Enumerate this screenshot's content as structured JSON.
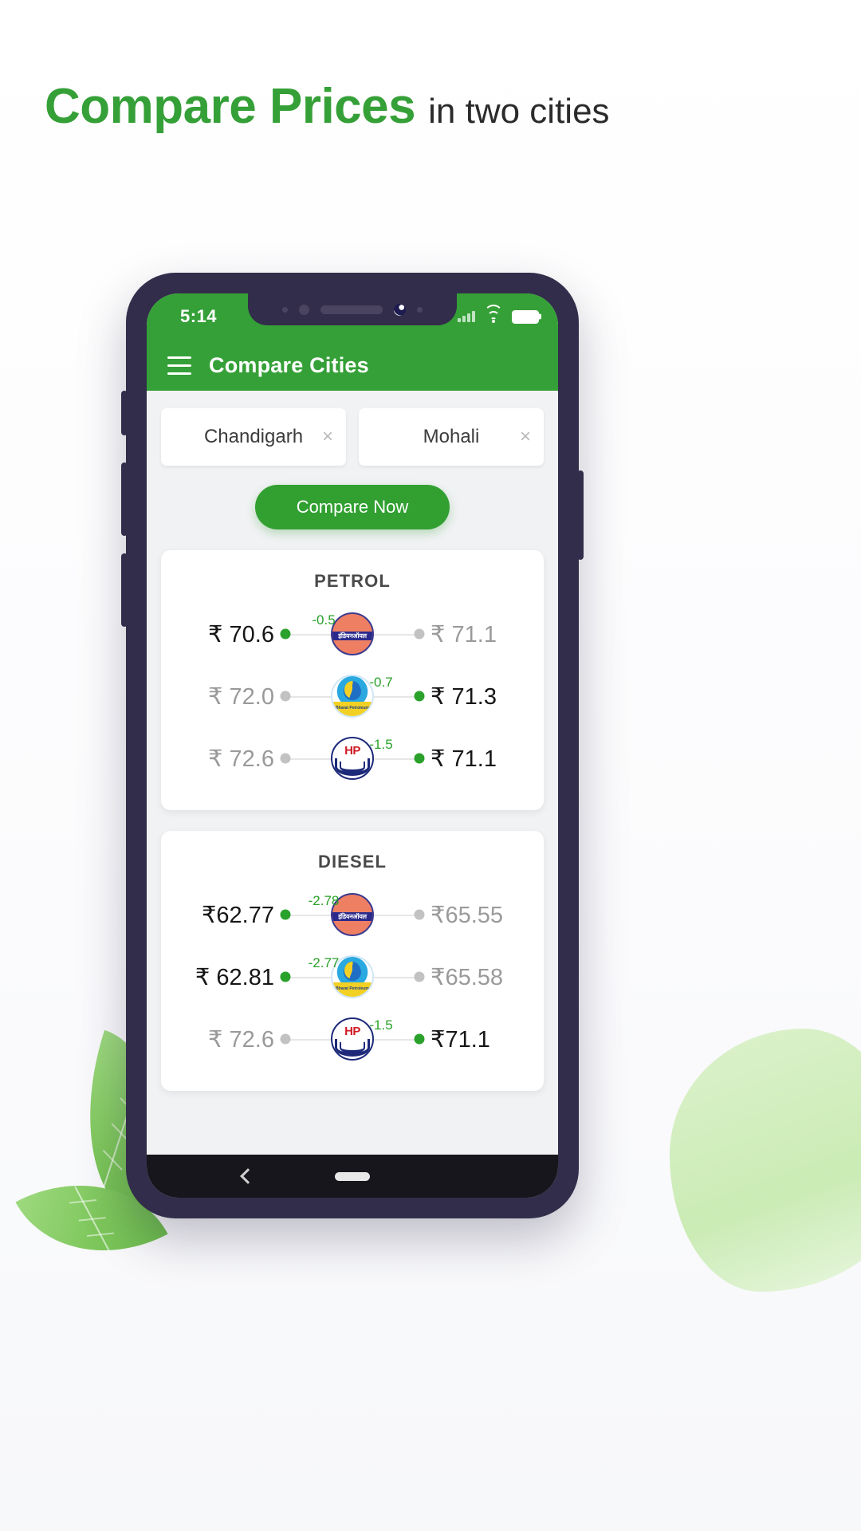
{
  "promo": {
    "headline_strong": "Compare Prices",
    "headline_light": "in two cities",
    "accent_color": "#35a037"
  },
  "phone": {
    "status": {
      "time": "5:14",
      "wifi_icon": "wifi-icon",
      "battery_icon": "battery-full-icon"
    },
    "appbar": {
      "menu_icon": "hamburger-menu-icon",
      "title": "Compare Cities"
    },
    "cities": [
      {
        "name": "Chandigarh",
        "close_label": "×"
      },
      {
        "name": "Mohali",
        "close_label": "×"
      }
    ],
    "compare_button": "Compare Now",
    "fuel_cards": [
      {
        "title": "PETROL",
        "rows": [
          {
            "brand": "Indian Oil",
            "brand_icon": "indian-oil-logo-icon",
            "left_price": "₹ 70.6",
            "right_price": "₹ 71.1",
            "delta": "-0.5",
            "cheaper_side": "left"
          },
          {
            "brand": "Bharat Petroleum",
            "brand_icon": "bharat-petroleum-logo-icon",
            "left_price": "₹ 72.0",
            "right_price": "₹ 71.3",
            "delta": "-0.7",
            "cheaper_side": "right"
          },
          {
            "brand": "HP",
            "brand_icon": "hindustan-petroleum-logo-icon",
            "left_price": "₹ 72.6",
            "right_price": "₹ 71.1",
            "delta": "-1.5",
            "cheaper_side": "right"
          }
        ]
      },
      {
        "title": "DIESEL",
        "rows": [
          {
            "brand": "Indian Oil",
            "brand_icon": "indian-oil-logo-icon",
            "left_price": "₹62.77",
            "right_price": "₹65.55",
            "delta": "-2.78",
            "cheaper_side": "left"
          },
          {
            "brand": "Bharat Petroleum",
            "brand_icon": "bharat-petroleum-logo-icon",
            "left_price": "₹ 62.81",
            "right_price": "₹65.58",
            "delta": "-2.77",
            "cheaper_side": "left"
          },
          {
            "brand": "HP",
            "brand_icon": "hindustan-petroleum-logo-icon",
            "left_price": "₹ 72.6",
            "right_price": "₹71.1",
            "delta": "-1.5",
            "cheaper_side": "right"
          }
        ]
      }
    ],
    "navbar": {
      "back_icon": "back-chevron-icon",
      "home_pill_icon": "home-pill-icon"
    },
    "logo_text": {
      "iocl_band": "इंडियनऑयल",
      "bpcl_label": "Bharat Petroleum"
    }
  }
}
